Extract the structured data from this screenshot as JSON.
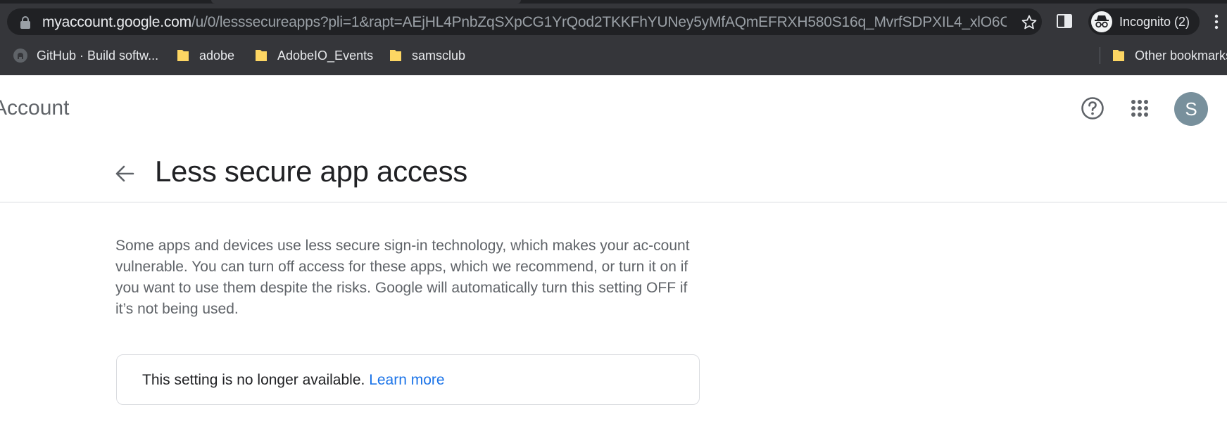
{
  "browser": {
    "url_domain": "myaccount.google.com",
    "url_path": "/u/0/lesssecureapps?pli=1&rapt=AEjHL4PnbZqSXpCG1YrQod2TKKFhYUNey5yMfAQmEFRXH580S16q_MvrfSDPXIL4_xlO6C...",
    "incognito_label": "Incognito (2)",
    "bookmarks": [
      {
        "label": "GitHub · Build softw...",
        "icon": "github-icon"
      },
      {
        "label": "adobe",
        "icon": "folder-icon"
      },
      {
        "label": "AdobeIO_Events",
        "icon": "folder-icon"
      },
      {
        "label": "samsclub",
        "icon": "folder-icon"
      }
    ],
    "other_bookmarks": "Other bookmarks"
  },
  "header": {
    "app_title": "Account",
    "avatar_letter": "S",
    "avatar_color": "#78909c"
  },
  "main": {
    "title": "Less secure app access",
    "description": "Some apps and devices use less secure sign-in technology, which makes your ac-count vulnerable. You can turn off access for these apps, which we recommend, or turn it on if you want to use them despite the risks. Google will automatically turn this setting OFF if it’s not being used.",
    "notice_text": "This setting is no longer available. ",
    "learn_more": "Learn more"
  },
  "colors": {
    "chrome_bg": "#35363a",
    "link": "#1a73e8",
    "folder": "#fdd663"
  }
}
